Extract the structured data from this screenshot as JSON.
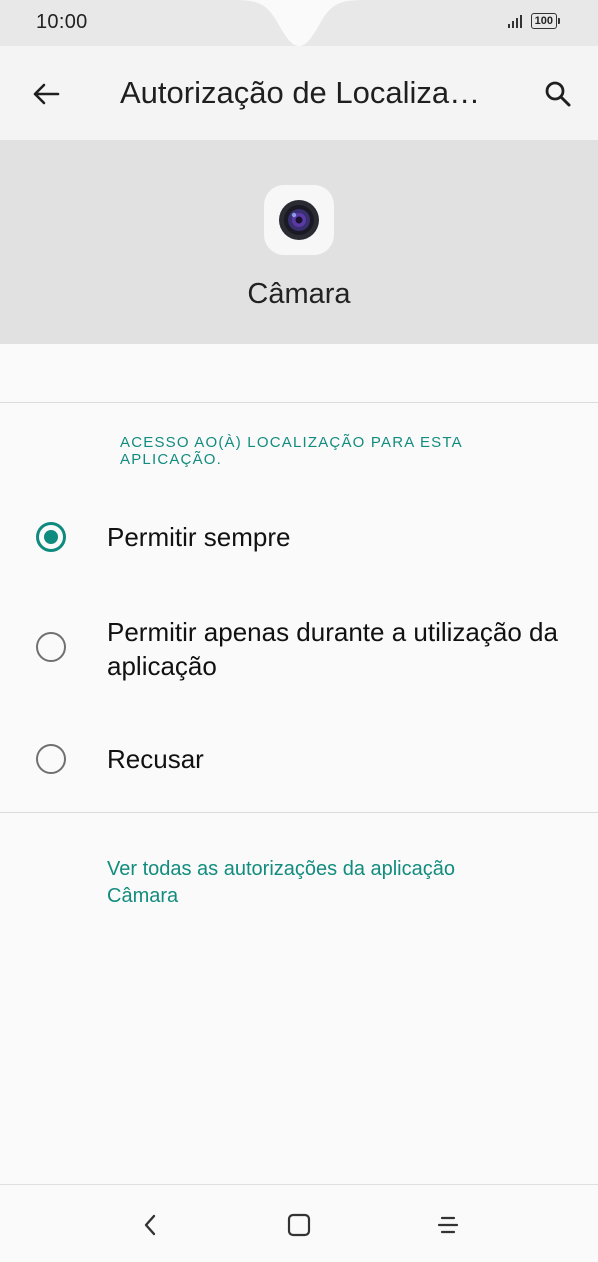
{
  "status_bar": {
    "time": "10:00",
    "battery": "100"
  },
  "app_bar": {
    "title": "Autorização de Localiza…",
    "back_icon": "arrow-left-icon",
    "search_icon": "search-icon"
  },
  "app_header": {
    "icon": "camera-app-icon",
    "name": "Câmara"
  },
  "section": {
    "title": "ACESSO AO(À) LOCALIZAÇÃO PARA ESTA APLICAÇÃO."
  },
  "options": [
    {
      "label": "Permitir sempre",
      "selected": true
    },
    {
      "label": "Permitir apenas durante a utilização da aplicação",
      "selected": false
    },
    {
      "label": "Recusar",
      "selected": false
    }
  ],
  "link": {
    "text": "Ver todas as autorizações da aplicação Câmara"
  },
  "nav_bar": {
    "back_icon": "chevron-left-icon",
    "home_icon": "square-home-icon",
    "menu_icon": "menu-lines-icon"
  },
  "colors": {
    "accent": "#0e8a7e",
    "header_bg": "#e1e1e1",
    "app_bar_bg": "#f4f4f4",
    "page_bg": "#fafafa"
  }
}
